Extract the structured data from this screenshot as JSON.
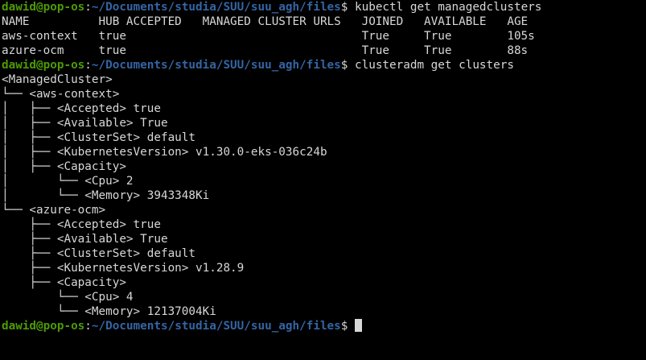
{
  "prompt": {
    "user_host": "dawid@pop-os",
    "colon": ":",
    "path": "~/Documents/studia/SUU/suu_agh/files",
    "symbol": "$ "
  },
  "commands": {
    "first": "kubectl get managedclusters",
    "second": "clusteradm get clusters",
    "third": ""
  },
  "table": {
    "header": "NAME          HUB ACCEPTED   MANAGED CLUSTER URLS   JOINED   AVAILABLE   AGE",
    "rows": [
      "aws-context   true                                  True     True        105s",
      "azure-ocm     true                                  True     True        88s"
    ]
  },
  "tree": [
    "<ManagedCluster>",
    "└── <aws-context>",
    "│   ├── <Accepted> true",
    "│   ├── <Available> True",
    "│   ├── <ClusterSet> default",
    "│   ├── <KubernetesVersion> v1.30.0-eks-036c24b",
    "│   ├── <Capacity>",
    "│       └── <Cpu> 2",
    "│       └── <Memory> 3943348Ki",
    "└── <azure-ocm>",
    "    ├── <Accepted> true",
    "    ├── <Available> True",
    "    ├── <ClusterSet> default",
    "    ├── <KubernetesVersion> v1.28.9",
    "    ├── <Capacity>",
    "        └── <Cpu> 4",
    "        └── <Memory> 12137004Ki"
  ],
  "colors": {
    "background": "#000000",
    "foreground": "#d7d7d7",
    "prompt_user": "#4e9a06",
    "prompt_path": "#3465a4"
  }
}
